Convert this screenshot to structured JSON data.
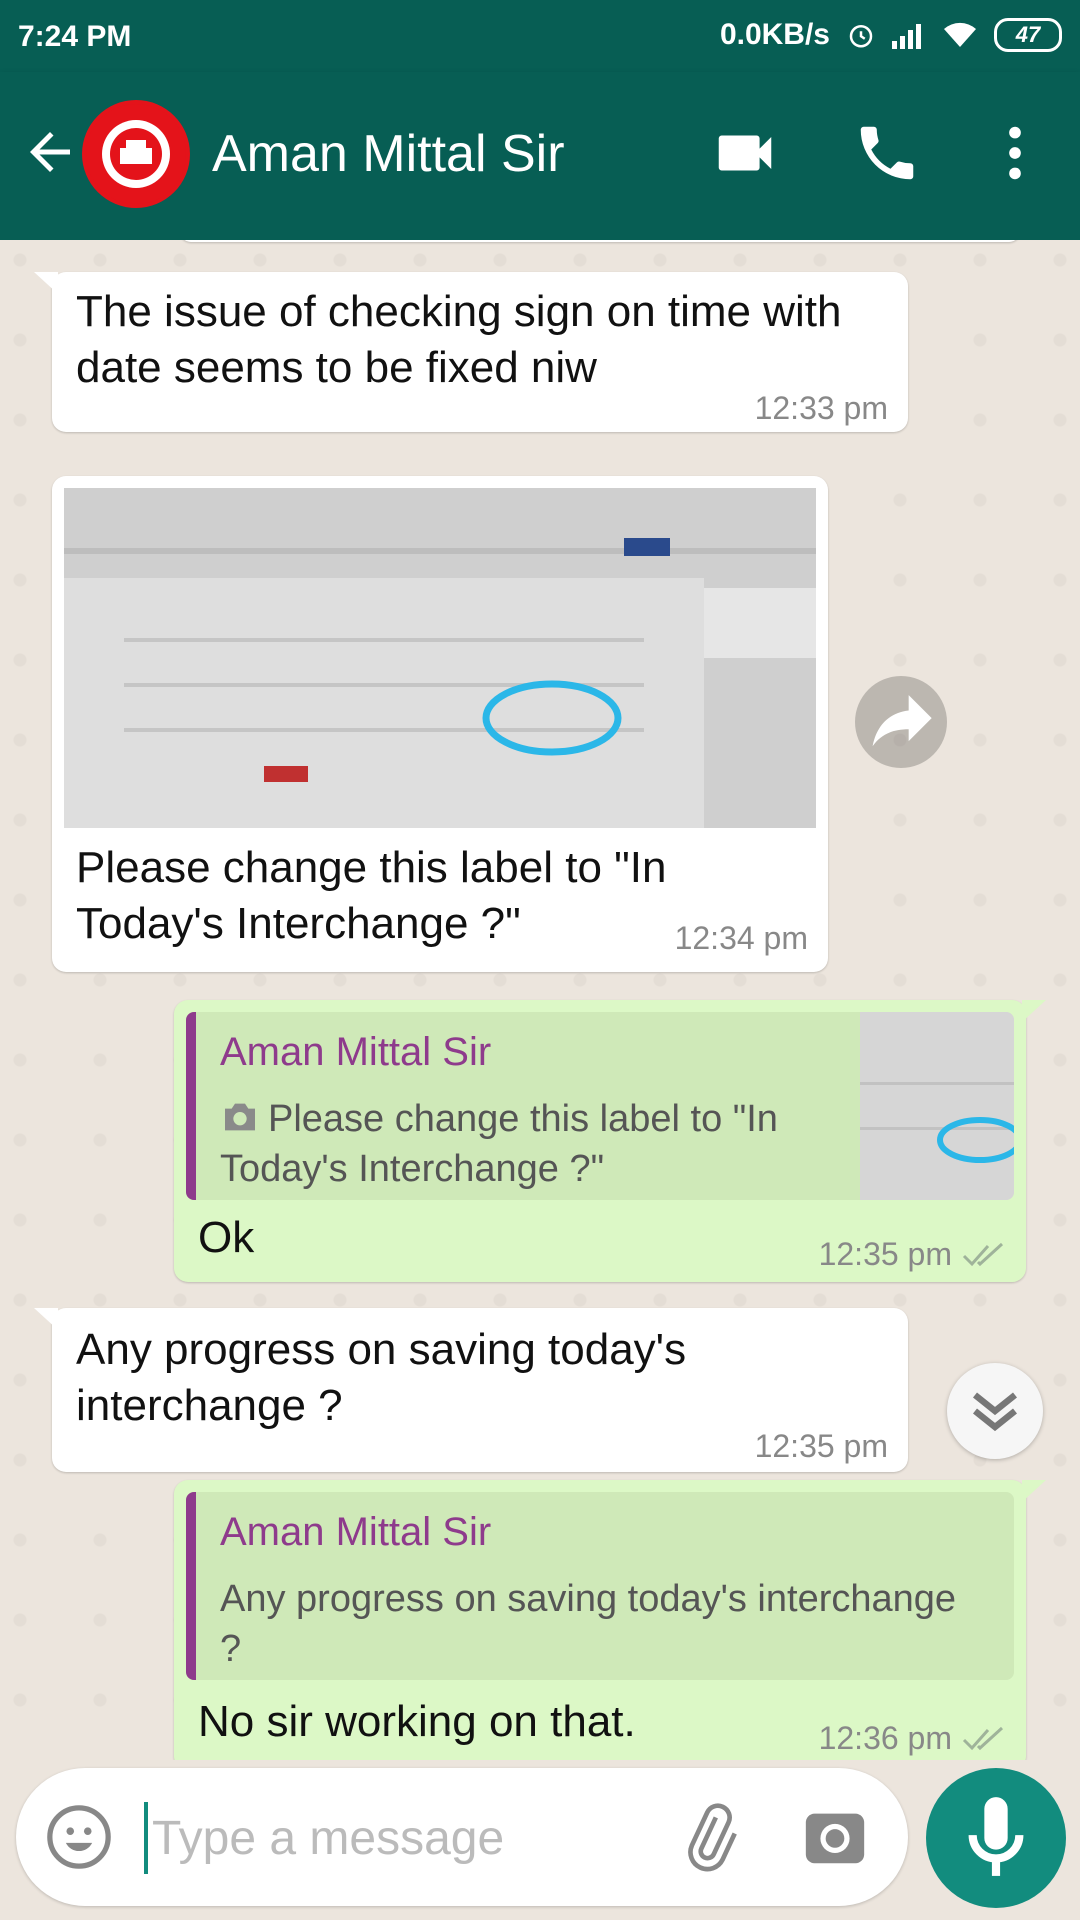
{
  "status_bar": {
    "time": "7:24 PM",
    "net_speed": "0.0KB/s",
    "battery": "47"
  },
  "header": {
    "contact_name": "Aman Mittal Sir",
    "icons": [
      "back-arrow-icon",
      "avatar",
      "video-call-icon",
      "phone-icon",
      "more-vert-icon"
    ]
  },
  "messages": [
    {
      "direction": "in",
      "text": "The issue of checking sign on time with date seems to be fixed niw",
      "time": "12:33 pm"
    },
    {
      "direction": "in",
      "type": "image",
      "caption": "Please change this label to \"In Today's Interchange ?\"",
      "time": "12:34 pm"
    },
    {
      "direction": "out",
      "reply_to": {
        "name": "Aman Mittal Sir",
        "text": "Please change this label to \"In Today's Interchange ?\""
      },
      "text": "Ok",
      "time": "12:35 pm",
      "status": "read"
    },
    {
      "direction": "in",
      "text": "Any progress on saving today's interchange ?",
      "time": "12:35 pm"
    },
    {
      "direction": "out",
      "reply_to": {
        "name": "Aman Mittal Sir",
        "text": "Any progress on saving today's interchange ?"
      },
      "text": "No sir working on that.",
      "time": "12:36 pm",
      "status": "read"
    }
  ],
  "composer": {
    "placeholder": "Type a message",
    "value": ""
  },
  "colors": {
    "header": "#075e54",
    "incoming": "#ffffff",
    "outgoing": "#dcf8c6",
    "quote_accent": "#8e3b8c",
    "mic_button": "#128c7e"
  }
}
